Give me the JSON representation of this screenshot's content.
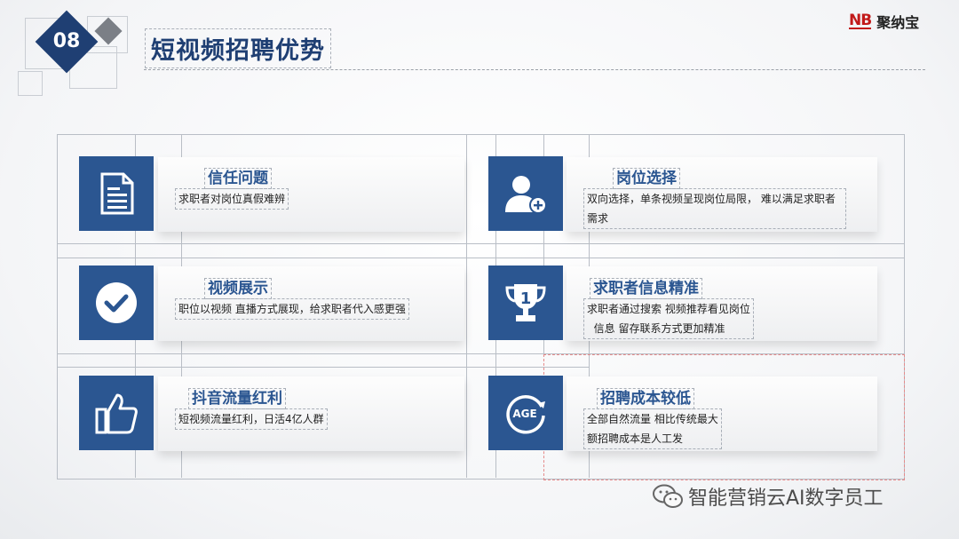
{
  "header": {
    "section_number": "08",
    "title": "短视频招聘优势",
    "logo_mark": "NB",
    "logo_text": "聚纳宝"
  },
  "cards": [
    {
      "title": "信任问题",
      "desc": "求职者对岗位真假难辨",
      "icon": "document-icon"
    },
    {
      "title": "岗位选择",
      "desc": "双向选择，单条视频呈现岗位局限， 难以满足求职者需求",
      "icon": "user-add-icon"
    },
    {
      "title": "视频展示",
      "desc": "职位以视频 直播方式展现，给求职者代入感更强",
      "icon": "check-circle-icon"
    },
    {
      "title": "求职者信息精准",
      "desc": "求职者通过搜索 视频推荐看见岗位\n  信息 留存联系方式更加精准",
      "icon": "trophy-icon"
    },
    {
      "title": "抖音流量红利",
      "desc": "短视频流量红利，日活4亿人群",
      "icon": "thumbs-up-icon"
    },
    {
      "title": "招聘成本较低",
      "desc": "全部自然流量 相比传统最大\n额招聘成本是人工发",
      "icon": "age-icon"
    }
  ],
  "icon_labels": {
    "age": "AGE",
    "trophy": "1"
  },
  "watermark": "智能营销云AI数字员工",
  "colors": {
    "primary": "#2b5691",
    "dark_navy": "#1f3f73",
    "logo_red": "#c21a1a"
  }
}
